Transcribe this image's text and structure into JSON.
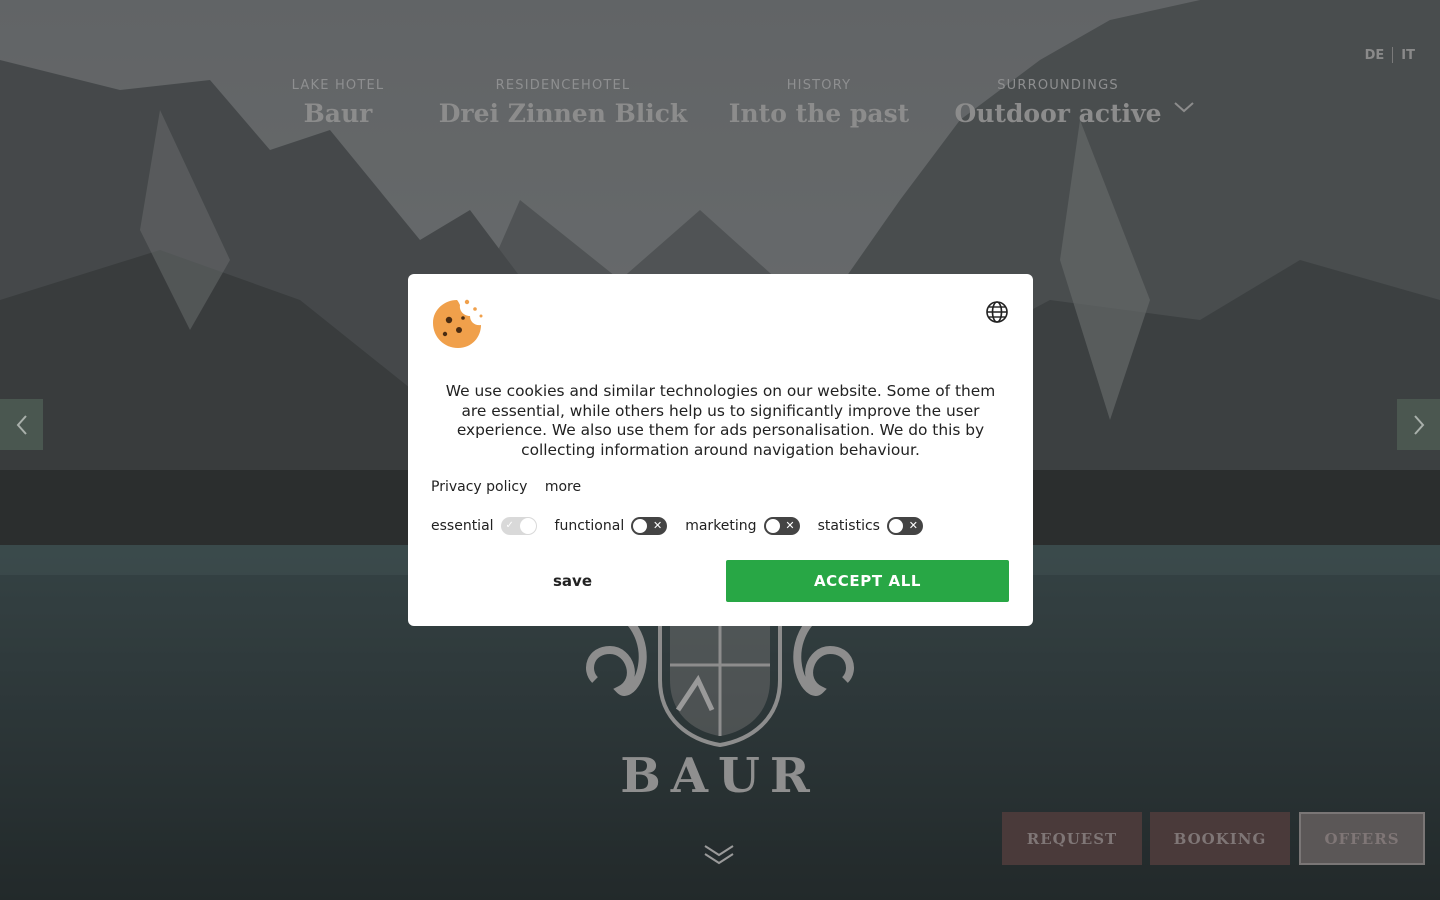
{
  "nav": {
    "items": [
      {
        "kicker": "LAKE HOTEL",
        "title": "Baur"
      },
      {
        "kicker": "RESIDENCEHOTEL",
        "title": "Drei Zinnen Blick"
      },
      {
        "kicker": "HISTORY",
        "title": "Into the past"
      },
      {
        "kicker": "SURROUNDINGS",
        "title": "Outdoor active"
      }
    ],
    "more_icon": "chevron-down-icon"
  },
  "languages": [
    "DE",
    "IT"
  ],
  "logo": {
    "text": "BAUR"
  },
  "cta": {
    "request": "REQUEST",
    "booking": "BOOKING",
    "offers": "OFFERS"
  },
  "cookie_banner": {
    "text": "We use cookies and similar technologies on our website. Some of them are essential, while others help us to significantly improve the user experience. We also use them for ads personalisation. We do this by collecting information around navigation behaviour.",
    "links": {
      "privacy": "Privacy policy",
      "more": "more"
    },
    "categories": [
      {
        "label": "essential",
        "state": "on-locked"
      },
      {
        "label": "functional",
        "state": "off"
      },
      {
        "label": "marketing",
        "state": "off"
      },
      {
        "label": "statistics",
        "state": "off"
      }
    ],
    "save_label": "save",
    "accept_label": "ACCEPT ALL"
  },
  "colors": {
    "accept": "#28a745",
    "cta_bg": "#4a3a3a",
    "cookie": "#f0a04b"
  }
}
